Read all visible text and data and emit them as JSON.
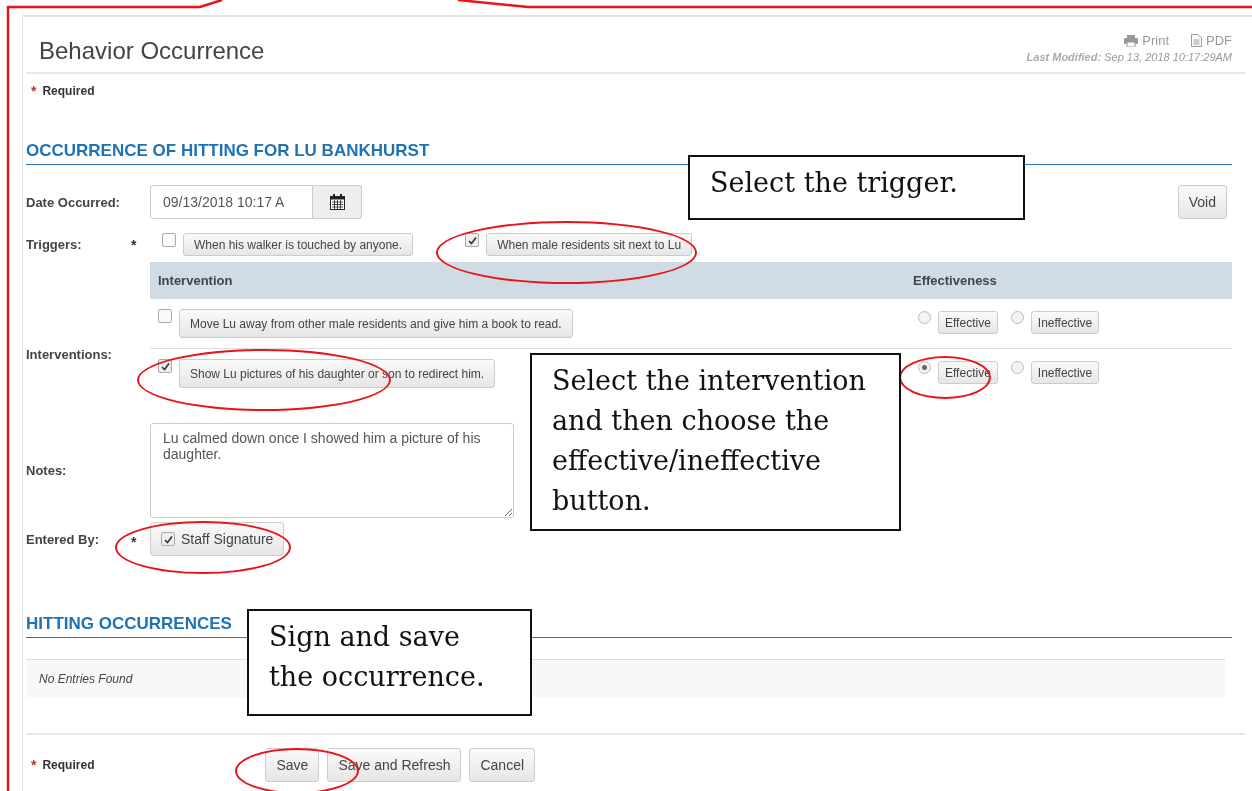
{
  "header": {
    "title": "Behavior Occurrence",
    "actions": [
      {
        "kind": "print",
        "label": "Print"
      },
      {
        "kind": "pdf",
        "label": "PDF"
      }
    ],
    "last_modified_label": "Last Modified:",
    "last_modified_value": "Sep 13, 2018 10:17:29AM"
  },
  "required_top": {
    "marker": "*",
    "label": "Required"
  },
  "form": {
    "section_title": "OCCURRENCE OF HITTING FOR LU BANKHURST",
    "date": {
      "label": "Date Occurred:",
      "value": "09/13/2018 10:17 A"
    },
    "void_button": "Void",
    "triggers": {
      "label": "Triggers:",
      "required_marker": "*",
      "items": [
        {
          "label": "When his walker is touched by anyone.",
          "checked": false
        },
        {
          "label": "When male residents sit next to Lu",
          "checked": true
        }
      ]
    },
    "interventions": {
      "label": "Interventions:",
      "columns": [
        "Intervention",
        "Effectiveness"
      ],
      "rows": [
        {
          "label": "Move Lu away from other male residents and give him a book to read.",
          "checked": false,
          "options": [
            {
              "label": "Effective",
              "selected": false
            },
            {
              "label": "Ineffective",
              "selected": false
            }
          ]
        },
        {
          "label": "Show Lu pictures of his daughter or son to redirect him.",
          "checked": true,
          "options": [
            {
              "label": "Effective",
              "selected": true
            },
            {
              "label": "Ineffective",
              "selected": false
            }
          ]
        }
      ]
    },
    "notes": {
      "label": "Notes:",
      "value": "Lu calmed down once I showed him a picture of his daughter."
    },
    "entered_by": {
      "label": "Entered By:",
      "required_marker": "*",
      "signature": {
        "label": "Staff Signature",
        "checked": true
      }
    }
  },
  "history": {
    "title": "HITTING OCCURRENCES",
    "empty_text": "No Entries Found"
  },
  "footer": {
    "marker": "*",
    "label": "Required",
    "buttons": [
      "Save",
      "Save and Refresh",
      "Cancel"
    ]
  },
  "annotations": {
    "callouts": [
      {
        "text": "Select the trigger."
      },
      {
        "text": "Select the intervention and then choose the effective/ineffective button."
      },
      {
        "text": "Sign and save the occurrence."
      }
    ]
  }
}
